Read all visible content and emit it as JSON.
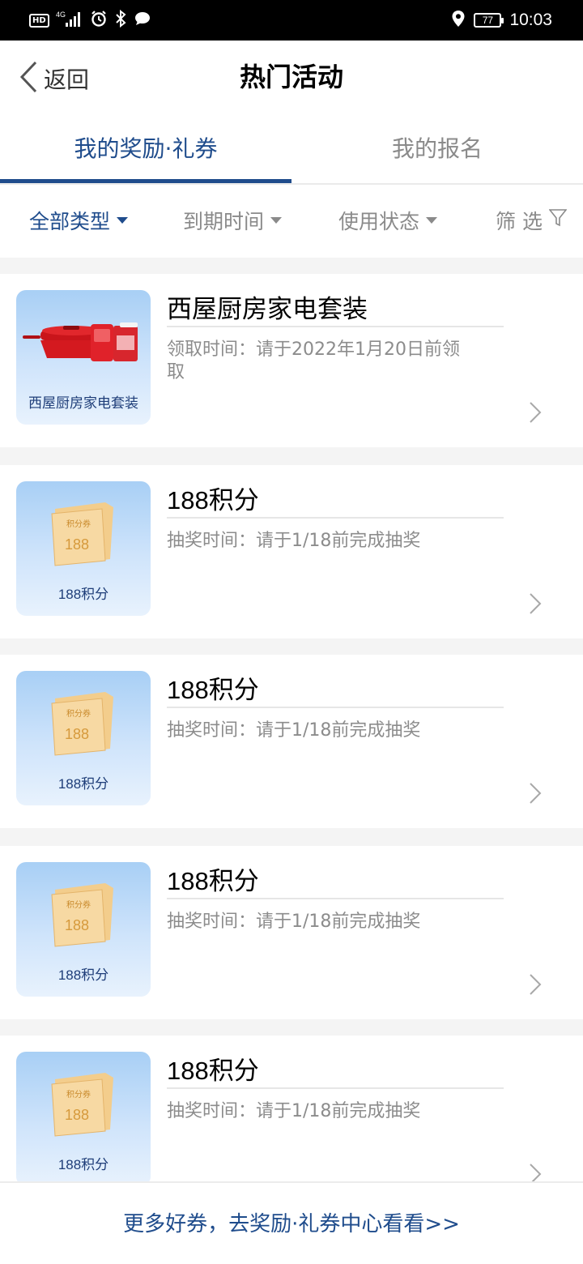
{
  "status_bar": {
    "network": "4G",
    "hd": "HD",
    "battery": "77",
    "time": "10:03"
  },
  "header": {
    "back_label": "返回",
    "title": "热门活动"
  },
  "tabs": [
    {
      "label": "我的奖励·礼券",
      "active": true
    },
    {
      "label": "我的报名",
      "active": false
    }
  ],
  "filters": [
    {
      "label": "全部类型",
      "active": true
    },
    {
      "label": "到期时间",
      "active": false
    },
    {
      "label": "使用状态",
      "active": false
    },
    {
      "label": "筛 选",
      "active": false
    }
  ],
  "rewards": [
    {
      "title": "西屋厨房家电套装",
      "thumb_caption": "西屋厨房家电套装",
      "thumb_type": "appliance",
      "desc": "领取时间：请于2022年1月20日前领取"
    },
    {
      "title": "188积分",
      "thumb_caption": "188积分",
      "thumb_type": "points",
      "ticket_label": "积分券",
      "ticket_value": "188",
      "desc": "抽奖时间：请于1/18前完成抽奖"
    },
    {
      "title": "188积分",
      "thumb_caption": "188积分",
      "thumb_type": "points",
      "ticket_label": "积分券",
      "ticket_value": "188",
      "desc": "抽奖时间：请于1/18前完成抽奖"
    },
    {
      "title": "188积分",
      "thumb_caption": "188积分",
      "thumb_type": "points",
      "ticket_label": "积分券",
      "ticket_value": "188",
      "desc": "抽奖时间：请于1/18前完成抽奖"
    },
    {
      "title": "188积分",
      "thumb_caption": "188积分",
      "thumb_type": "points",
      "ticket_label": "积分券",
      "ticket_value": "188",
      "desc": "抽奖时间：请于1/18前完成抽奖"
    }
  ],
  "footer": {
    "link_text": "更多好券，去奖励·礼券中心看看>>"
  },
  "colors": {
    "accent": "#1f4c8c",
    "muted": "#8a8a8a",
    "thumb_bg": "#bcdaf8"
  }
}
